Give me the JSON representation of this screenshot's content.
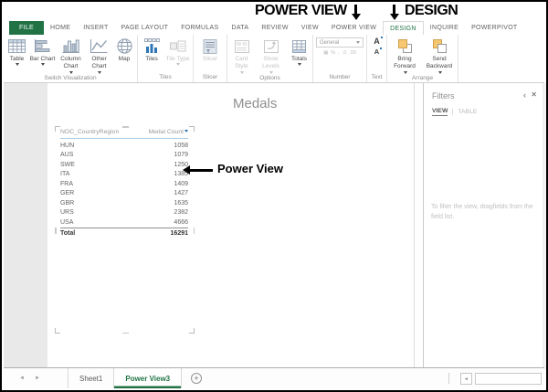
{
  "annotations": {
    "power_view_callout": "POWER VIEW",
    "design_callout": "DESIGN",
    "switch_visualization_callout": "Switch Visualization",
    "power_view_pointer": "Power View"
  },
  "ribbon": {
    "tabs": [
      {
        "label": "FILE"
      },
      {
        "label": "HOME"
      },
      {
        "label": "INSERT"
      },
      {
        "label": "PAGE LAYOUT"
      },
      {
        "label": "FORMULAS"
      },
      {
        "label": "DATA"
      },
      {
        "label": "REVIEW"
      },
      {
        "label": "VIEW"
      },
      {
        "label": "POWER VIEW"
      },
      {
        "label": "DESIGN"
      },
      {
        "label": "INQUIRE"
      },
      {
        "label": "POWERPIVOT"
      }
    ],
    "active_tab": "DESIGN",
    "buttons": {
      "table": "Table",
      "bar_chart": "Bar Chart",
      "column_chart": "Column Chart",
      "other_chart": "Other Chart",
      "map": "Map",
      "tiles": "Tiles",
      "tile_type": "Tile Type",
      "slicer": "Slicer",
      "card_style": "Card Style",
      "show_levels": "Show Levels",
      "totals": "Totals",
      "bring_forward": "Bring Forward",
      "send_backward": "Send Backward"
    },
    "number_format_value": "General",
    "group_labels": {
      "switch_visualization": "Switch Visualization",
      "tiles": "Tiles",
      "slicer": "Slicer",
      "options": "Options",
      "number": "Number",
      "text": "Text",
      "arrange": "Arrange"
    }
  },
  "canvas": {
    "title": "Medals",
    "table": {
      "headers": [
        "NOC_CountryRegion",
        "Medal Count"
      ],
      "rows": [
        {
          "country": "HUN",
          "count": "1058"
        },
        {
          "country": "AUS",
          "count": "1079"
        },
        {
          "country": "SWE",
          "count": "1250"
        },
        {
          "country": "ITA",
          "count": "1385"
        },
        {
          "country": "FRA",
          "count": "1409"
        },
        {
          "country": "GER",
          "count": "1427"
        },
        {
          "country": "GBR",
          "count": "1635"
        },
        {
          "country": "URS",
          "count": "2382"
        },
        {
          "country": "USA",
          "count": "4666"
        }
      ],
      "total_label": "Total",
      "total_value": "16291"
    }
  },
  "filters": {
    "title": "Filters",
    "tabs": [
      "VIEW",
      "TABLE"
    ],
    "hint": "To filter the view, dragfields from the field list."
  },
  "sheet_bar": {
    "sheets": [
      {
        "label": "Sheet1"
      },
      {
        "label": "Power View3"
      }
    ],
    "active_sheet": "Power View3"
  },
  "icons": {
    "close": "✕",
    "chevron_left": "‹",
    "nav_left": "◄",
    "nav_right": "►",
    "scroll_left": "◄",
    "add_sheet": "+",
    "accounting": "▦",
    "percent": "%",
    "comma": ",",
    "increase_decimal": ".0",
    "decrease_decimal": ".00",
    "font_letter": "A"
  },
  "colors": {
    "excel_green": "#217346",
    "tiles_blue": "#2e75b6",
    "arrange_orange": "#f7c670",
    "header_underline_blue": "#a9cbe9"
  }
}
